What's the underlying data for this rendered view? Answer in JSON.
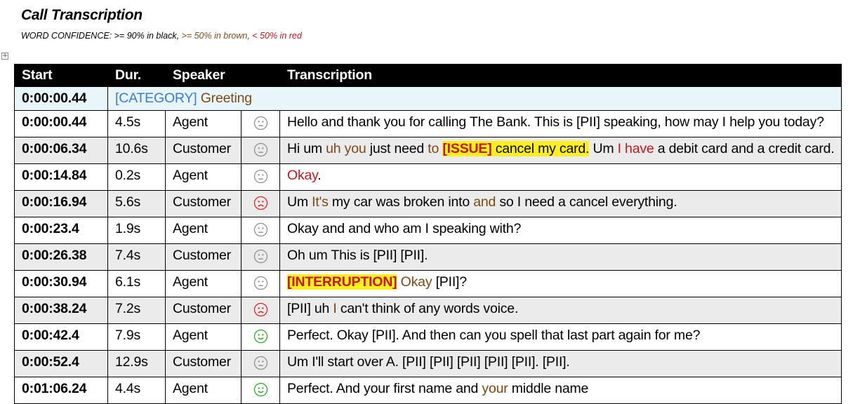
{
  "document": {
    "title": "Call Transcription",
    "legend": {
      "prefix": "WORD CONFIDENCE: >= 90% in black, ",
      "brown": ">= 50% in brown, ",
      "red": "< 50% in red"
    }
  },
  "table": {
    "headers": {
      "start": "Start",
      "duration": "Dur.",
      "speaker": "Speaker",
      "transcription": "Transcription"
    },
    "category_row": {
      "start": "0:00:00.44",
      "tag": "[CATEGORY]",
      "name": "Greeting"
    },
    "rows": [
      {
        "start": "0:00:00.44",
        "duration": "4.5s",
        "speaker": "Agent",
        "sentiment": "neutral",
        "segments": [
          {
            "text": "Hello and thank you for calling The Bank. This is [PII] speaking, how may I help you today?"
          }
        ]
      },
      {
        "start": "0:00:06.34",
        "duration": "10.6s",
        "speaker": "Customer",
        "sentiment": "neutral",
        "segments": [
          {
            "text": "Hi um "
          },
          {
            "text": "uh you",
            "conf": "brown"
          },
          {
            "text": " just need "
          },
          {
            "text": "to",
            "conf": "brown"
          },
          {
            "text": " "
          },
          {
            "text": "[ISSUE]",
            "style": "hl-tag"
          },
          {
            "text": " cancel my card.",
            "style": "hl"
          },
          {
            "text": " Um "
          },
          {
            "text": "I have",
            "conf": "red"
          },
          {
            "text": " a debit card and a credit card."
          }
        ]
      },
      {
        "start": "0:00:14.84",
        "duration": "0.2s",
        "speaker": "Agent",
        "sentiment": "neutral",
        "segments": [
          {
            "text": "Okay",
            "conf": "red"
          },
          {
            "text": "."
          }
        ]
      },
      {
        "start": "0:00:16.94",
        "duration": "5.6s",
        "speaker": "Customer",
        "sentiment": "negative",
        "segments": [
          {
            "text": "Um "
          },
          {
            "text": "It's",
            "conf": "brown"
          },
          {
            "text": " my car was broken into "
          },
          {
            "text": "and",
            "conf": "brown"
          },
          {
            "text": " so I need a cancel everything."
          }
        ]
      },
      {
        "start": "0:00:23.4",
        "duration": "1.9s",
        "speaker": "Agent",
        "sentiment": "neutral",
        "segments": [
          {
            "text": "Okay and and who am I speaking with?"
          }
        ]
      },
      {
        "start": "0:00:26.38",
        "duration": "7.4s",
        "speaker": "Customer",
        "sentiment": "neutral",
        "segments": [
          {
            "text": "Oh um This is [PII] [PII]."
          }
        ]
      },
      {
        "start": "0:00:30.94",
        "duration": "6.1s",
        "speaker": "Agent",
        "sentiment": "neutral",
        "segments": [
          {
            "text": "[INTERRUPTION]",
            "style": "hl-tag-int"
          },
          {
            "text": "  "
          },
          {
            "text": "Okay",
            "conf": "brown"
          },
          {
            "text": " [PII]?"
          }
        ]
      },
      {
        "start": "0:00:38.24",
        "duration": "7.2s",
        "speaker": "Customer",
        "sentiment": "negative",
        "segments": [
          {
            "text": "[PII] uh "
          },
          {
            "text": "I",
            "conf": "brown"
          },
          {
            "text": " can't think of any words voice."
          }
        ]
      },
      {
        "start": "0:00:42.4",
        "duration": "7.9s",
        "speaker": "Agent",
        "sentiment": "positive",
        "segments": [
          {
            "text": "Perfect. Okay [PII]. And then can you spell that last part again for me?"
          }
        ]
      },
      {
        "start": "0:00:52.4",
        "duration": "12.9s",
        "speaker": "Customer",
        "sentiment": "neutral",
        "segments": [
          {
            "text": "Um I'll start over A. [PII] [PII] [PII] [PII] [PII]. [PII]."
          }
        ]
      },
      {
        "start": "0:01:06.24",
        "duration": "4.4s",
        "speaker": "Agent",
        "sentiment": "positive",
        "segments": [
          {
            "text": "Perfect. And your first name and "
          },
          {
            "text": "your",
            "conf": "brown"
          },
          {
            "text": " middle name"
          }
        ]
      }
    ]
  },
  "colors": {
    "brown": "#7a4a14",
    "red": "#c4161c",
    "category_tag": "#3a7ad8",
    "highlight": "#ffef1a",
    "sentiment_neutral": "#8e8e8e",
    "sentiment_negative": "#d6202a",
    "sentiment_positive": "#2aa52a"
  }
}
